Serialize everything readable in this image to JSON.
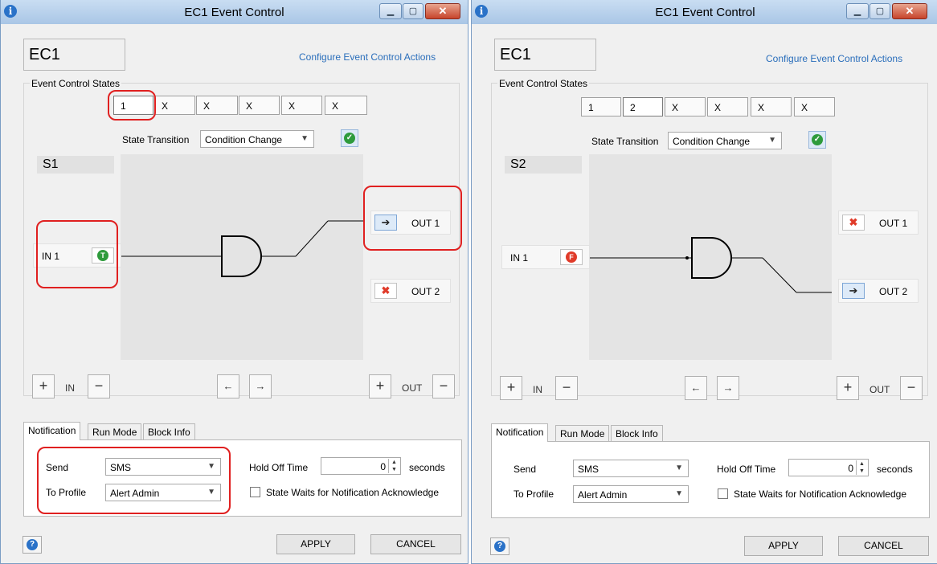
{
  "windows": [
    {
      "title": "EC1 Event Control",
      "name": "EC1",
      "configure_link": "Configure Event Control Actions",
      "states_label": "Event Control States",
      "state_buttons": [
        "1",
        "X",
        "X",
        "X",
        "X",
        "X"
      ],
      "selected_state": "1",
      "transition_label": "State Transition",
      "transition_value": "Condition Change",
      "state_name": "S1",
      "input": {
        "label": "IN 1",
        "badge": "T",
        "state": "true"
      },
      "outputs": [
        {
          "label": "OUT 1",
          "icon": "arrow-right-icon",
          "active": true
        },
        {
          "label": "OUT 2",
          "icon": "x-icon",
          "active": false
        }
      ],
      "in_label": "IN",
      "out_label": "OUT",
      "tabs": [
        "Notification",
        "Run Mode",
        "Block Info"
      ],
      "notification": {
        "send_label": "Send",
        "send_value": "SMS",
        "profile_label": "To Profile",
        "profile_value": "Alert Admin",
        "holdoff_label": "Hold Off Time",
        "holdoff_value": "0",
        "holdoff_unit": "seconds",
        "ack_label": "State Waits for Notification Acknowledge"
      },
      "apply_label": "APPLY",
      "cancel_label": "CANCEL"
    },
    {
      "title": "EC1 Event Control",
      "name": "EC1",
      "configure_link": "Configure Event Control Actions",
      "states_label": "Event Control States",
      "state_buttons": [
        "1",
        "2",
        "X",
        "X",
        "X",
        "X"
      ],
      "selected_state": "2",
      "transition_label": "State Transition",
      "transition_value": "Condition Change",
      "state_name": "S2",
      "input": {
        "label": "IN 1",
        "badge": "F",
        "state": "false"
      },
      "outputs": [
        {
          "label": "OUT 1",
          "icon": "x-icon",
          "active": false
        },
        {
          "label": "OUT 2",
          "icon": "arrow-right-icon",
          "active": true
        }
      ],
      "in_label": "IN",
      "out_label": "OUT",
      "tabs": [
        "Notification",
        "Run Mode",
        "Block Info"
      ],
      "notification": {
        "send_label": "Send",
        "send_value": "SMS",
        "profile_label": "To Profile",
        "profile_value": "Alert Admin",
        "holdoff_label": "Hold Off Time",
        "holdoff_value": "0",
        "holdoff_unit": "seconds",
        "ack_label": "State Waits for Notification Acknowledge"
      },
      "apply_label": "APPLY",
      "cancel_label": "CANCEL"
    }
  ],
  "colors": {
    "highlight": "#e02020",
    "link": "#2a6ebb",
    "true_badge": "#2e9b3c",
    "false_badge": "#e03b2a"
  }
}
